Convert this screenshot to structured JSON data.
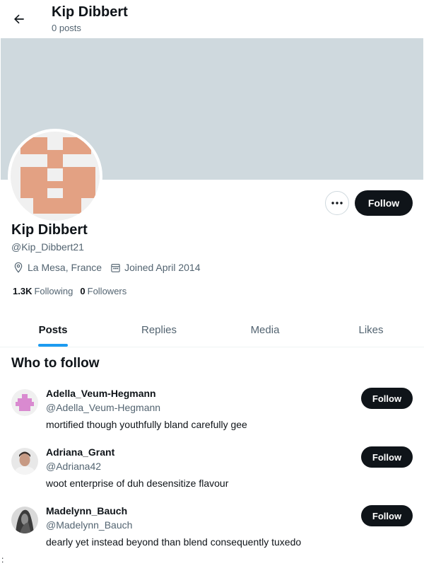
{
  "header": {
    "title": "Kip Dibbert",
    "post_count": "0 posts",
    "back_icon": "arrow-left-icon"
  },
  "colors": {
    "banner": "#cfd9de",
    "avatar_primary": "#e3a183",
    "avatar_secondary": "#f0f0f0",
    "accent": "#1d9bf0",
    "button": "#0f1419"
  },
  "profile": {
    "name": "Kip Dibbert",
    "handle": "@Kip_Dibbert21",
    "location": "La Mesa, France",
    "joined": "Joined April 2014",
    "following_count": "1.3K",
    "following_label": "Following",
    "followers_count": "0",
    "followers_label": "Followers",
    "follow_label": "Follow",
    "more_icon": "more-dots-icon"
  },
  "tabs": [
    {
      "label": "Posts",
      "active": true
    },
    {
      "label": "Replies",
      "active": false
    },
    {
      "label": "Media",
      "active": false
    },
    {
      "label": "Likes",
      "active": false
    }
  ],
  "who_to_follow": {
    "title": "Who to follow",
    "items": [
      {
        "name": "Adella_Veum-Hegmann",
        "handle": "@Adella_Veum-Hegmann",
        "bio": "mortified though youthfully bland carefully gee",
        "follow_label": "Follow"
      },
      {
        "name": "Adriana_Grant",
        "handle": "@Adriana42",
        "bio": "woot enterprise of duh desensitize flavour",
        "follow_label": "Follow"
      },
      {
        "name": "Madelynn_Bauch",
        "handle": "@Madelynn_Bauch",
        "bio": "dearly yet instead beyond than blend consequently tuxedo",
        "follow_label": "Follow"
      }
    ]
  },
  "stray_char": ":"
}
